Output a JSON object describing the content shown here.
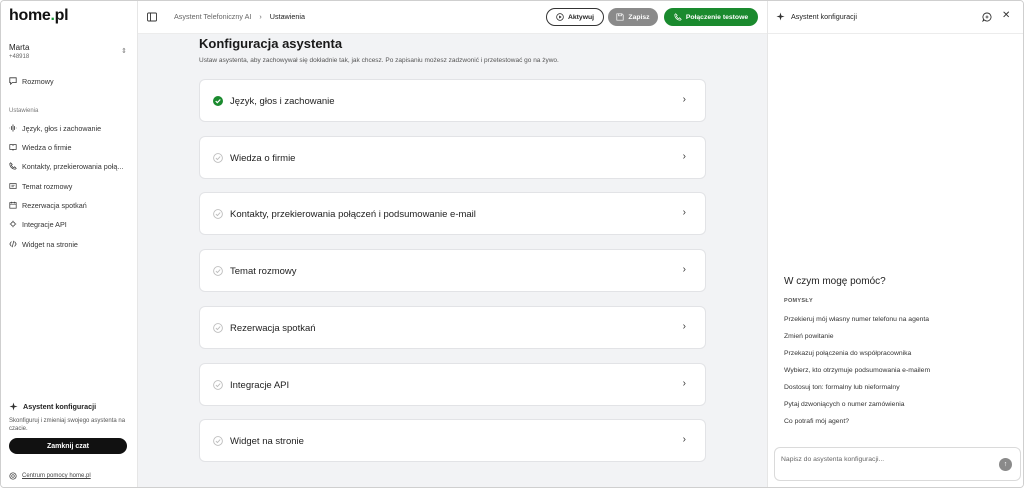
{
  "colors": {
    "brand_green": "#1a9a3a",
    "test_button": "#1a8a2e",
    "save_button": "#8a8a8a",
    "main_bg": "#f2f3f5"
  },
  "sidebar": {
    "logo_main": "home",
    "logo_dot": ".",
    "logo_tld": "pl",
    "user": {
      "name": "Marta",
      "id": "+48918"
    },
    "conversations": {
      "label": "Rozmowy",
      "icon": "chat-icon"
    },
    "section_label": "Ustawienia",
    "items": [
      {
        "label": "Język, głos i zachowanie",
        "icon": "voice-icon"
      },
      {
        "label": "Wiedza o firmie",
        "icon": "book-icon"
      },
      {
        "label": "Kontakty, przekierowania połą...",
        "icon": "phone-forward-icon"
      },
      {
        "label": "Temat rozmowy",
        "icon": "message-icon"
      },
      {
        "label": "Rezerwacja spotkań",
        "icon": "calendar-icon"
      },
      {
        "label": "Integracje API",
        "icon": "plug-icon"
      },
      {
        "label": "Widget na stronie",
        "icon": "code-icon"
      }
    ],
    "assistant": {
      "title": "Asystent konfiguracji",
      "description": "Skonfiguruj i zmieniaj swojego asystenta na czacie.",
      "close_label": "Zamknij czat"
    },
    "help_link": "Centrum pomocy home.pl"
  },
  "topbar": {
    "breadcrumb": [
      "Asystent Telefoniczny AI",
      "Ustawienia"
    ],
    "active_label": "Aktywuj",
    "save_label": "Zapisz",
    "test_label": "Połączenie testowe"
  },
  "main": {
    "title": "Konfiguracja asystenta",
    "subtitle": "Ustaw asystenta, aby zachowywał się dokładnie tak, jak chcesz. Po zapisaniu możesz zadzwonić i przetestować go na żywo.",
    "sections": [
      {
        "label": "Język, głos i zachowanie",
        "completed": true
      },
      {
        "label": "Wiedza o firmie",
        "completed": false
      },
      {
        "label": "Kontakty, przekierowania połączeń i podsumowanie e-mail",
        "completed": false
      },
      {
        "label": "Temat rozmowy",
        "completed": false
      },
      {
        "label": "Rezerwacja spotkań",
        "completed": false
      },
      {
        "label": "Integracje API",
        "completed": false
      },
      {
        "label": "Widget na stronie",
        "completed": false
      }
    ]
  },
  "right_panel": {
    "title": "Asystent konfiguracji",
    "help_title": "W czym mogę pomóc?",
    "ideas_label": "POMYSŁY",
    "suggestions": [
      "Przekieruj mój własny numer telefonu na agenta",
      "Zmień powitanie",
      "Przekazuj połączenia do współpracownika",
      "Wybierz, kto otrzymuje podsumowania e-mailem",
      "Dostosuj ton: formalny lub nieformalny",
      "Pytaj dzwoniących o numer zamówienia",
      "Co potrafi mój agent?"
    ],
    "input_placeholder": "Napisz do asystenta konfiguracji..."
  }
}
